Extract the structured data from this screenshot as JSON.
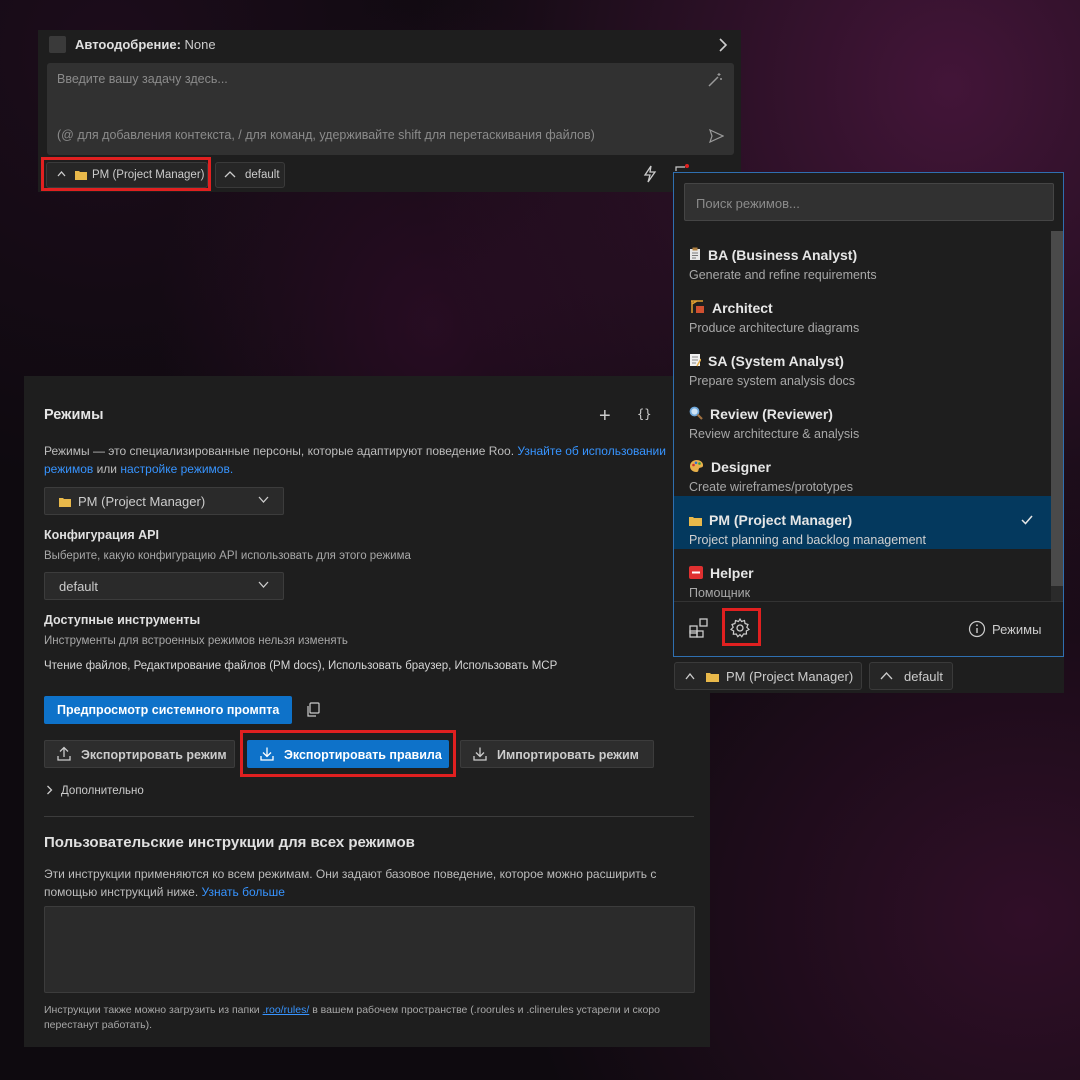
{
  "chat": {
    "auto_label": "Автоодобрение:",
    "auto_value": "None",
    "placeholder_line1": "Введите вашу задачу здесь...",
    "placeholder_line2": "(@ для добавления контекста, / для команд, удерживайте shift для перетаскивания файлов)",
    "mode_pill": "PM (Project Manager)",
    "config_pill": "default"
  },
  "settings": {
    "title": "Режимы",
    "desc_prefix": "Режимы — это специализированные персоны, которые адаптируют поведение Roo.",
    "desc_link1": "Узнайте об использовании режимов",
    "desc_mid": "или",
    "desc_link2": "настройке режимов.",
    "mode_select": "PM (Project Manager)",
    "api_title": "Конфигурация API",
    "api_desc": "Выберите, какую конфигурацию API использовать для этого режима",
    "api_select": "default",
    "tools_title": "Доступные инструменты",
    "tools_desc": "Инструменты для встроенных режимов нельзя изменять",
    "tools_list": "Чтение файлов, Редактирование файлов (PM docs), Использовать браузер, Использовать MCP",
    "preview_button": "Предпросмотр системного промпта",
    "export_mode_button": "Экспортировать режим",
    "export_rules_button": "Экспортировать правила",
    "import_mode_button": "Импортировать режим",
    "advanced": "Дополнительно",
    "custom_title": "Пользовательские инструкции для всех режимов",
    "custom_desc": "Эти инструкции применяются ко всем режимам. Они задают базовое поведение, которое можно расширить с помощью инструкций ниже.",
    "custom_link": "Узнать больше",
    "footer_prefix": "Инструкции также можно загрузить из папки",
    "footer_link": ".roo/rules/",
    "footer_suffix": "в вашем рабочем пространстве (.roorules и .clinerules устарели и скоро перестанут работать)."
  },
  "modes_popup": {
    "search_placeholder": "Поиск режимов...",
    "items": [
      {
        "name": "BA (Business Analyst)",
        "desc": "Generate and refine requirements",
        "icon": "clipboard-icon",
        "color": "#d9d9d9"
      },
      {
        "name": "Architect",
        "desc": "Produce architecture diagrams",
        "icon": "building-construction-icon",
        "color": "#e0a030"
      },
      {
        "name": "SA (System Analyst)",
        "desc": "Prepare system analysis docs",
        "icon": "memo-icon",
        "color": "#f0f0f0"
      },
      {
        "name": "Review (Reviewer)",
        "desc": "Review architecture & analysis",
        "icon": "magnifier-icon",
        "color": "#6fa8dc"
      },
      {
        "name": "Designer",
        "desc": "Create wireframes/prototypes",
        "icon": "palette-icon",
        "color": "#e8b04a"
      },
      {
        "name": "PM (Project Manager)",
        "desc": "Project planning and backlog management",
        "icon": "folder-icon",
        "color": "#e8b84a",
        "active": true
      },
      {
        "name": "Helper",
        "desc": "Помощник",
        "icon": "sos-icon",
        "color": "#e03030"
      }
    ],
    "help_label": "Режимы",
    "bottom_mode_pill": "PM (Project Manager)",
    "bottom_config_pill": "default"
  },
  "colors": {
    "accent": "#0e72c9",
    "highlight": "#e02020",
    "link": "#3794ff"
  }
}
